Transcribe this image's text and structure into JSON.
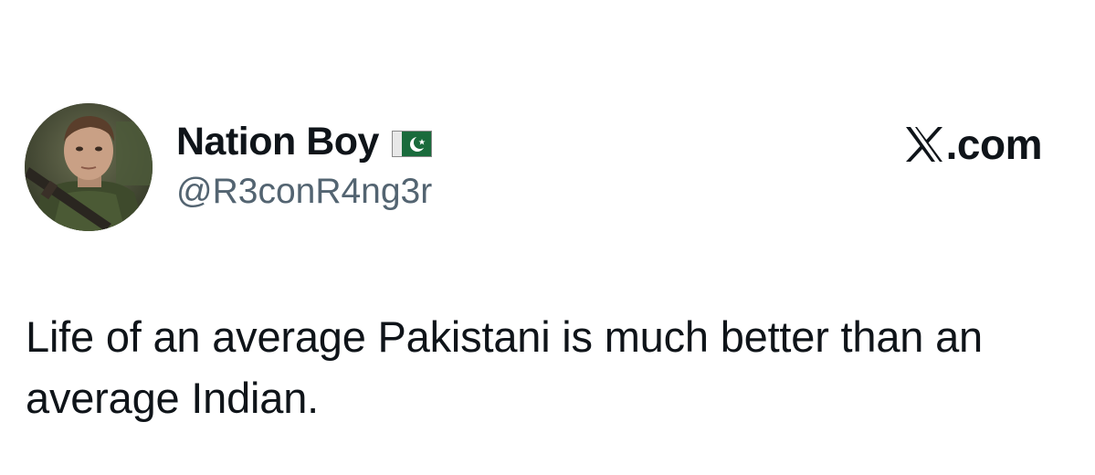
{
  "post": {
    "author": {
      "display_name": "Nation Boy",
      "handle": "@R3conR4ng3r",
      "badge_icon": "pakistan-flag-icon",
      "avatar_icon": "profile-photo"
    },
    "brand": {
      "logo_icon": "x-logo-icon",
      "domain_suffix": ".com"
    },
    "text": "Life of an average Pakistani is much better than an average Indian."
  },
  "colors": {
    "text_primary": "#0f1419",
    "text_secondary": "#536471",
    "background": "#ffffff",
    "flag_green": "#01411c"
  }
}
